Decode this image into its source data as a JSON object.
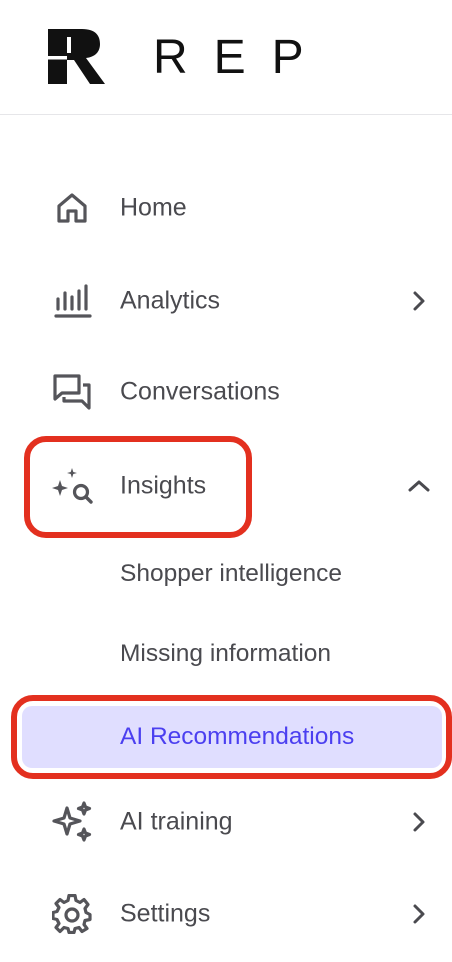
{
  "brand": {
    "name": "REP"
  },
  "nav": [
    {
      "key": "home",
      "label": "Home",
      "icon": "home-icon"
    },
    {
      "key": "analytics",
      "label": "Analytics",
      "icon": "bar-chart-icon",
      "chevron": "right"
    },
    {
      "key": "conversations",
      "label": "Conversations",
      "icon": "chat-bubbles-icon"
    },
    {
      "key": "insights",
      "label": "Insights",
      "icon": "sparkle-search-icon",
      "chevron": "up",
      "expanded": true,
      "children": [
        {
          "key": "shopper-intelligence",
          "label": "Shopper intelligence"
        },
        {
          "key": "missing-information",
          "label": "Missing information"
        },
        {
          "key": "ai-recommendations",
          "label": "AI Recommendations",
          "active": true
        }
      ]
    },
    {
      "key": "ai-training",
      "label": "AI training",
      "icon": "sparkles-icon",
      "chevron": "right"
    },
    {
      "key": "settings",
      "label": "Settings",
      "icon": "gear-icon",
      "chevron": "right"
    }
  ],
  "colors": {
    "active_bg": "#e0deff",
    "active_text": "#4b3ff0",
    "highlight_outline": "#e3301f",
    "text": "#4a4a4f",
    "icon": "#55555a"
  }
}
